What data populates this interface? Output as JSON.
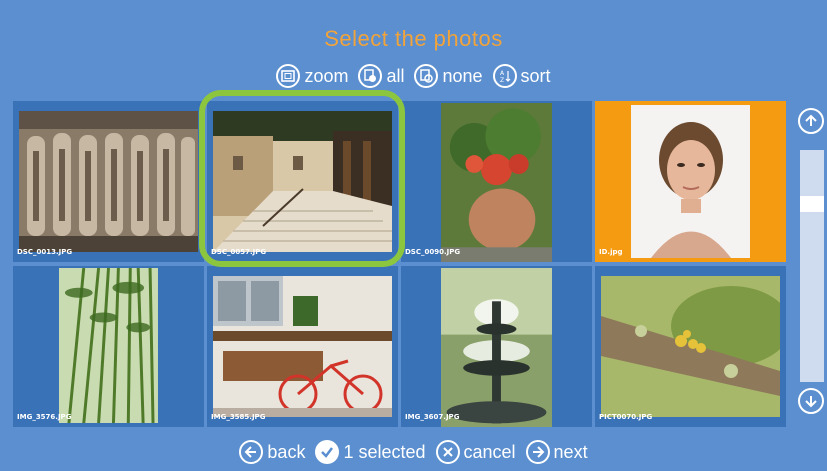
{
  "header": {
    "title": "Select the photos"
  },
  "toolbar": {
    "zoom": {
      "label": "zoom",
      "icon": "zoom-icon"
    },
    "all": {
      "label": "all",
      "icon": "select-all-icon"
    },
    "none": {
      "label": "none",
      "icon": "select-none-icon"
    },
    "sort": {
      "label": "sort",
      "icon": "sort-az-icon"
    }
  },
  "photos": [
    {
      "name": "DSC_0013.JPG",
      "selected": false,
      "highlighted": false
    },
    {
      "name": "DSC_0057.JPG",
      "selected": true,
      "highlighted": false
    },
    {
      "name": "DSC_0090.JPG",
      "selected": false,
      "highlighted": false
    },
    {
      "name": "ID.jpg",
      "selected": false,
      "highlighted": true
    },
    {
      "name": "IMG_3576.JPG",
      "selected": false,
      "highlighted": false
    },
    {
      "name": "IMG_3585.JPG",
      "selected": false,
      "highlighted": false
    },
    {
      "name": "IMG_3607.JPG",
      "selected": false,
      "highlighted": false
    },
    {
      "name": "PICT0070.JPG",
      "selected": false,
      "highlighted": false
    }
  ],
  "footer": {
    "back": {
      "label": "back",
      "icon": "arrow-left-icon"
    },
    "selected": {
      "label": "1 selected",
      "icon": "check-icon"
    },
    "cancel": {
      "label": "cancel",
      "icon": "close-icon"
    },
    "next": {
      "label": "next",
      "icon": "arrow-right-icon"
    }
  },
  "colors": {
    "background": "#5b8fcf",
    "tile": "#3a72b8",
    "title": "#f2a33a",
    "highlight": "#f49b11",
    "selection_ring": "#8cc63f"
  }
}
